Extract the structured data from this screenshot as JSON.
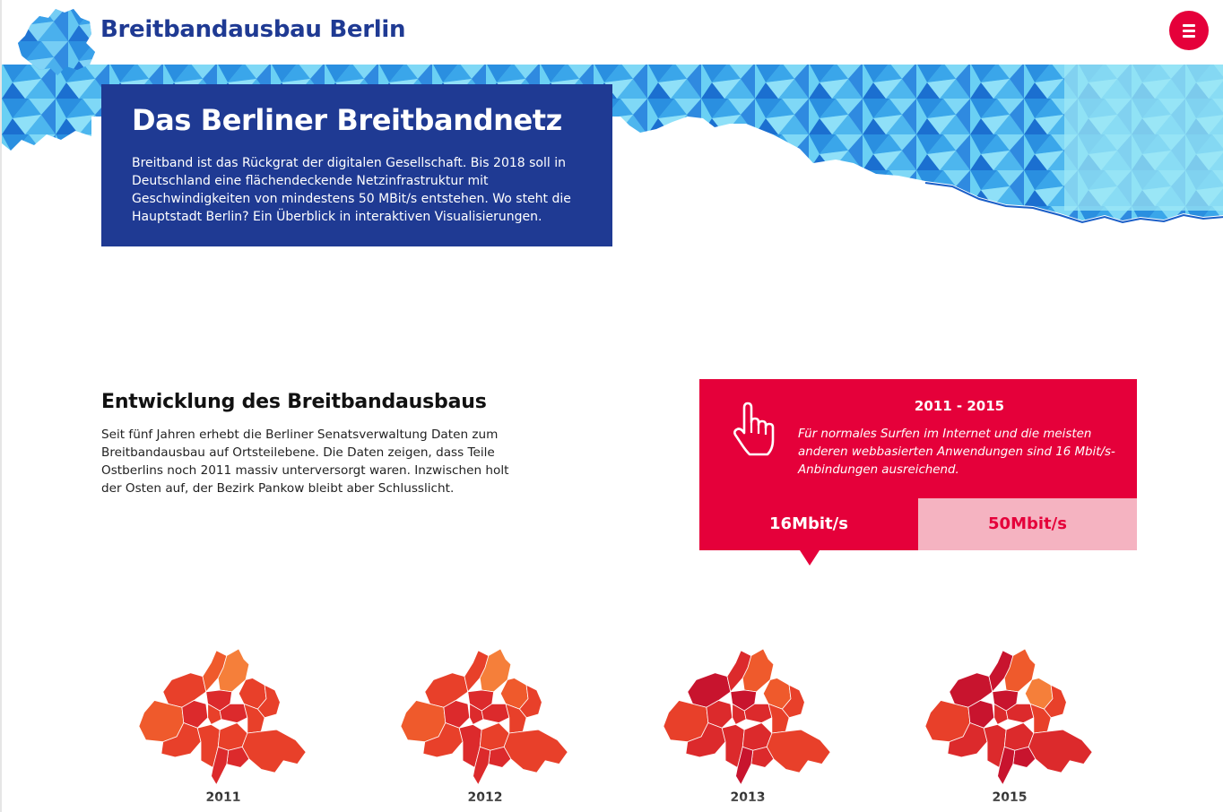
{
  "header": {
    "title": "Breitbandausbau Berlin",
    "logo_icon": "berlin-map-logo-icon",
    "menu_icon": "hamburger-menu-icon"
  },
  "hero": {
    "title": "Das Berliner Breitbandnetz",
    "text": "Breitband ist das Rückgrat der digitalen Gesellschaft. Bis 2018 soll in Deutschland eine flächendeckende Netzinfrastruktur mit Geschwindigkeiten von mindestens 50 MBit/s entstehen. Wo steht die Hauptstadt Berlin? Ein Überblick in interaktiven Visualisierungen."
  },
  "section": {
    "heading": "Entwicklung des Breitbandausbaus",
    "text": "Seit fünf Jahren erhebt die Berliner Senatsverwaltung Daten zum Breitbandausbau auf Ortsteilebene. Die Daten zeigen, dass Teile Ostberlins noch 2011 massiv unterversorgt waren. Inzwischen holt der Osten auf, der Bezirk Pankow bleibt aber Schlusslicht."
  },
  "info_panel": {
    "icon": "hand-pointer-icon",
    "years": "2011 - 2015",
    "description": "Für normales Surfen im Internet und die meisten anderen webbasierten Anwendungen sind 16 Mbit/s-Anbindungen ausreichend.",
    "tabs": [
      {
        "label": "16Mbit/s",
        "selected": true
      },
      {
        "label": "50Mbit/s",
        "selected": false
      }
    ]
  },
  "maps": [
    {
      "year": "2011"
    },
    {
      "year": "2012"
    },
    {
      "year": "2013"
    },
    {
      "year": "2015"
    }
  ],
  "colors": {
    "brand_blue": "#1f3a93",
    "accent_red": "#e5003a",
    "tab_inactive": "#f5b3c1",
    "hero_cyan": "#58c8f0",
    "map_scale": [
      "#f57f3a",
      "#ef5a2c",
      "#e8402a",
      "#dc2a2c",
      "#c8142e"
    ]
  }
}
